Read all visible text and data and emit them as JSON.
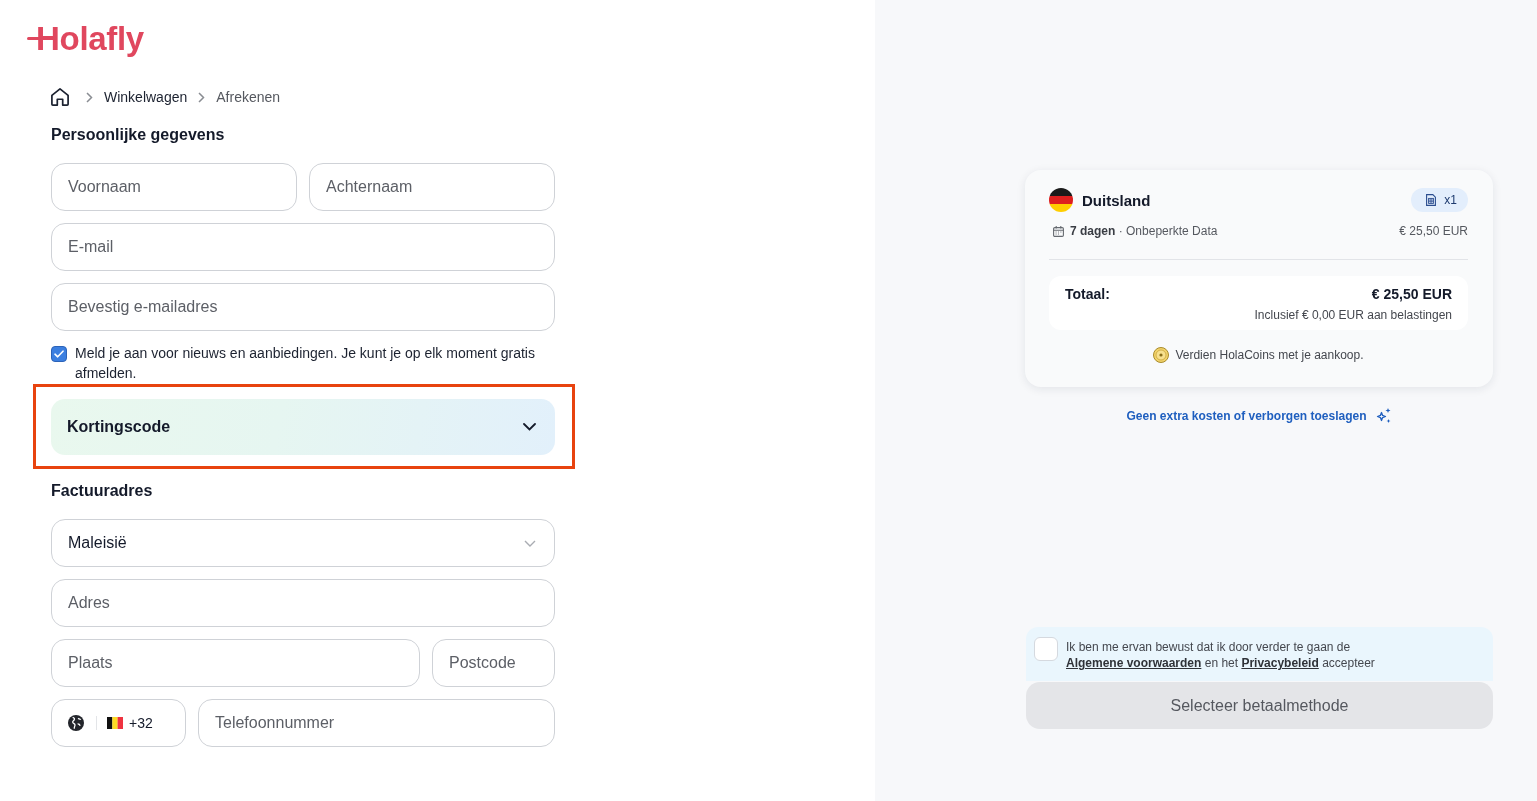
{
  "logo": {
    "text": "Holafly"
  },
  "breadcrumb": [
    {
      "label": "Winkelwagen",
      "current": false
    },
    {
      "label": "Afrekenen",
      "current": true
    }
  ],
  "personal": {
    "title": "Persoonlijke gegevens",
    "rows": [
      {
        "fields": [
          {
            "kind": "text",
            "placeholder": "Voornaam"
          },
          {
            "kind": "text",
            "placeholder": "Achternaam"
          }
        ]
      },
      {
        "fields": [
          {
            "kind": "text",
            "placeholder": "E-mail"
          }
        ]
      },
      {
        "fields": [
          {
            "kind": "text",
            "placeholder": "Bevestig e-mailadres"
          }
        ]
      }
    ]
  },
  "newsletter": {
    "checked": true,
    "label": "Meld je aan voor nieuws en aanbiedingen. Je kunt je op elk moment gratis afmelden."
  },
  "discount_code": {
    "label": "Kortingscode",
    "expanded": false,
    "highlighted": true
  },
  "billing": {
    "title": "Factuuradres",
    "rows": [
      {
        "fields": [
          {
            "kind": "select",
            "value": "Maleisië"
          }
        ]
      },
      {
        "fields": [
          {
            "kind": "text",
            "placeholder": "Adres"
          }
        ]
      },
      {
        "fields": [
          {
            "kind": "text",
            "placeholder": "Plaats"
          },
          {
            "kind": "text",
            "placeholder": "Postcode"
          }
        ]
      },
      {
        "fields": [
          {
            "kind": "phone_code",
            "value": "+32"
          },
          {
            "kind": "text",
            "placeholder": "Telefoonnummer"
          }
        ]
      }
    ]
  },
  "order": {
    "items": [
      {
        "country": "Duitsland",
        "quantity": "x1",
        "details": "**7 dagen** · Onbeperkte Data",
        "price": "€ 25,50 EUR"
      }
    ],
    "total": {
      "label": "Totaal:",
      "amount": "€ 25,50 EUR",
      "tax_note": "Inclusief € 0,00 EUR aan belastingen"
    },
    "rewards": "Verdien HolaCoins met je aankoop."
  },
  "guarantee": {
    "text": "Geen extra kosten of verborgen toeslagen"
  },
  "terms": {
    "checked": false,
    "parts": [
      {
        "kind": "text",
        "text": "Ik ben me ervan bewust dat ik door verder te gaan de "
      },
      {
        "kind": "link",
        "text": "Algemene voorwaarden"
      },
      {
        "kind": "text",
        "text": " en het "
      },
      {
        "kind": "link",
        "text": "Privacybeleid"
      },
      {
        "kind": "text",
        "text": " accepteer"
      }
    ]
  },
  "pay_button": {
    "label": "Selecteer betaalmethode",
    "disabled": true
  }
}
